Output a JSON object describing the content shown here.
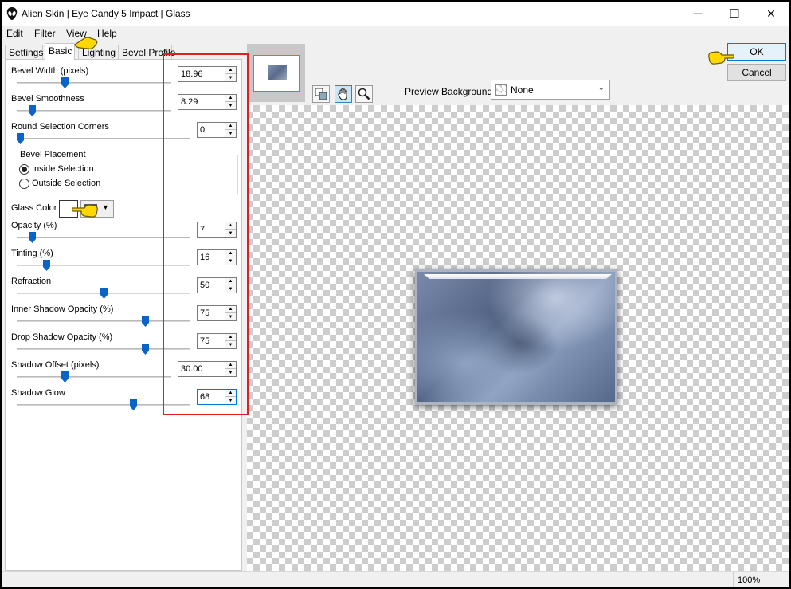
{
  "window": {
    "title": "Alien Skin | Eye Candy 5 Impact | Glass",
    "minimize_glyph": "—",
    "maximize_glyph": "☐",
    "close_glyph": "✕"
  },
  "menu": [
    "Edit",
    "Filter",
    "View",
    "Help"
  ],
  "tabs": [
    "Settings",
    "Basic",
    "Lighting",
    "Bevel Profile"
  ],
  "active_tab": "Basic",
  "controls": {
    "bevel_width": {
      "label": "Bevel Width (pixels)",
      "value": "18.96",
      "slider": 0.3
    },
    "bevel_smoothness": {
      "label": "Bevel Smoothness",
      "value": "8.29",
      "slider": 0.08
    },
    "round_corners": {
      "label": "Round Selection Corners",
      "value": "0",
      "slider": 0.0
    },
    "bevel_placement": {
      "label": "Bevel Placement",
      "options": [
        "Inside Selection",
        "Outside Selection"
      ],
      "selected": "Inside Selection"
    },
    "glass_color": {
      "label": "Glass Color",
      "swatch": "#ffffff"
    },
    "opacity": {
      "label": "Opacity (%)",
      "value": "7",
      "slider": 0.07
    },
    "tinting": {
      "label": "Tinting (%)",
      "value": "16",
      "slider": 0.16
    },
    "refraction": {
      "label": "Refraction",
      "value": "50",
      "slider": 0.5
    },
    "inner_shadow_opacity": {
      "label": "Inner Shadow Opacity (%)",
      "value": "75",
      "slider": 0.75
    },
    "drop_shadow_opacity": {
      "label": "Drop Shadow Opacity (%)",
      "value": "75",
      "slider": 0.75
    },
    "shadow_offset": {
      "label": "Shadow Offset (pixels)",
      "value": "30.00",
      "slider": 0.3
    },
    "shadow_glow": {
      "label": "Shadow Glow",
      "value": "68",
      "slider": 0.68
    }
  },
  "preview_background": {
    "label": "Preview Background:",
    "value": "None"
  },
  "buttons": {
    "ok": "OK",
    "cancel": "Cancel"
  },
  "status": {
    "zoom": "100%"
  },
  "colors": {
    "highlight_box": "#e02020",
    "slider_thumb": "#0a64c8",
    "pointer": "#ffd800"
  }
}
